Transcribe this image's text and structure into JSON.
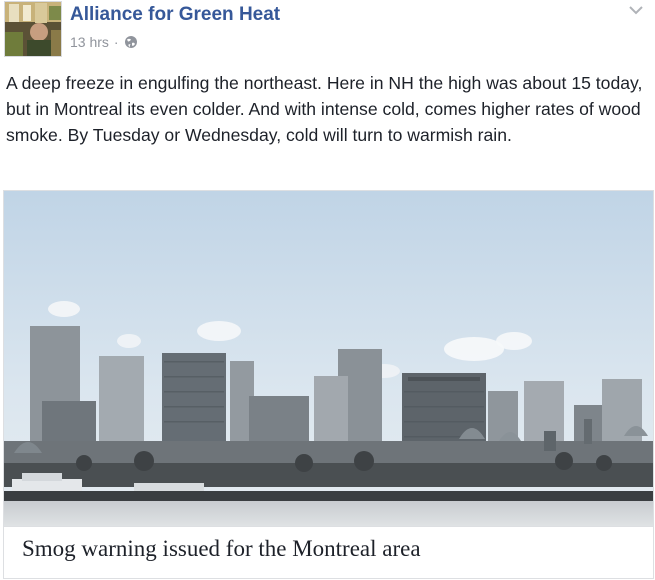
{
  "post": {
    "author": "Alliance for Green Heat",
    "time": "13 hrs",
    "separator": "·",
    "privacy_icon": "globe-icon",
    "menu_icon": "chevron-down-icon",
    "body": "A deep freeze in engulfing the northeast. Here in NH the high was about 15 today, but in Montreal its even colder. And with intense cold, comes higher rates of wood smoke. By Tuesday or Wednesday, cold will turn to warmish rain."
  },
  "attachment": {
    "title": "Smog warning issued for the Montreal area",
    "image_subject": "Montreal skyline with smoke plumes over a frozen river"
  },
  "colors": {
    "link_blue": "#365899",
    "meta_gray": "#90949c",
    "text": "#1d2129",
    "border": "#dddfe2"
  }
}
